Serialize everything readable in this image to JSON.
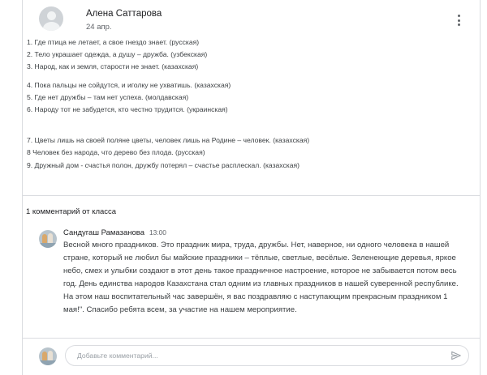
{
  "post": {
    "author": "Алена Саттарова",
    "date": "24 апр.",
    "lines": [
      "1. Где птица не летает, а свое гнездо знает. (русская)",
      "2. Тело украшает одежда, а душу – дружба. (узбекская)",
      "3. Народ, как и земля, старости не знает. (казахская)",
      "4. Пока пальцы не сойдутся, и иголку не ухватишь. (казахская)",
      "5. Где нет дружбы – там нет успеха. (молдавская)",
      "6. Народу тот не забудется, кто честно трудится. (украинская)",
      "7. Цветы лишь на своей поляне цветы, человек лишь на Родине – человек. (казахская)",
      "8 Человек без народа, что дерево без плода. (русская)",
      "9. Дружный дом - счастья полон, дружбу потерял – счастье расплескал. (казахская)"
    ]
  },
  "comments_header": "1 комментарий от класса",
  "comment": {
    "author": "Сандугаш Рамазанова",
    "time": "13:00",
    "text": "Весной много праздников. Это праздник мира, труда, дружбы. Нет, наверное, ни одного человека в нашей стране, который не любил бы майские праздники – тёплые, светлые, весёлые. Зеленеющие деревья, яркое небо, смех и улыбки создают в этот день такое праздничное настроение, которое не забывается потом весь год. День единства народов Казахстана стал одним из главных праздников в нашей суверенной республике. На этом наш воспитательный час завершён, я вас поздравляю с наступающим прекрасным праздником 1 мая!\". Спасибо ребята всем, за участие на нашем мероприятие."
  },
  "add_comment": {
    "placeholder": "Добавьте комментарий..."
  },
  "icons": {
    "menu": "more-vert-icon",
    "send": "send-icon",
    "author_avatar": "avatar-placeholder",
    "commenter_avatar": "avatar-photo"
  },
  "colors": {
    "text": "#3c4043",
    "muted": "#5f6368",
    "divider": "#dadce0"
  }
}
